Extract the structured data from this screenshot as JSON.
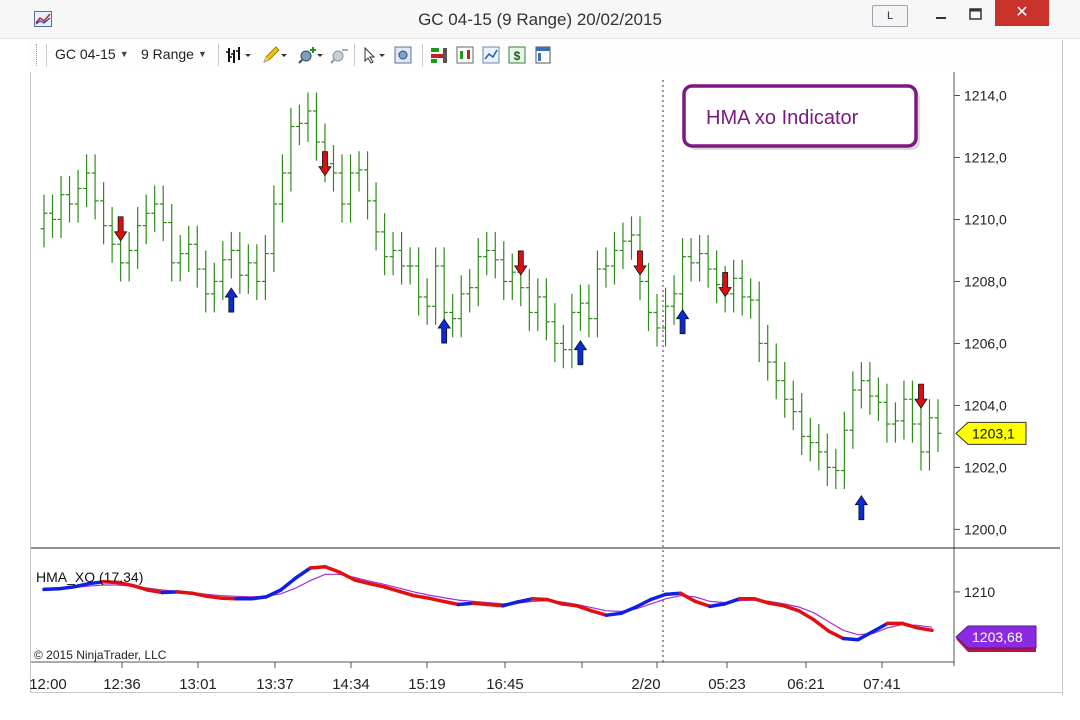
{
  "window": {
    "title": "GC 04-15 (9 Range)  20/02/2015",
    "layout_button": "L",
    "close_glyph": "✕"
  },
  "toolbar": {
    "instrument": "GC 04-15",
    "period": "9 Range"
  },
  "annotation": {
    "text": "HMA xo Indicator"
  },
  "indicator": {
    "label": "HMA_XO (17,34)",
    "price_tag": "1203,68",
    "axis_tick": "1210"
  },
  "copyright": "© 2015 NinjaTrader, LLC",
  "price_tag": "1203,1",
  "colors": {
    "bars": "#2e8b1a",
    "up_arrow": "#0a2bd8",
    "down_arrow": "#d81010",
    "hma_up": "#1020e0",
    "hma_down": "#e01010",
    "hma_signal": "#a030d0",
    "price_tag_bg": "#ffff00",
    "indicator_tag_bg": "#8a2be2",
    "annotation_border": "#7a1a80",
    "annotation_text": "#7a1a80"
  },
  "chart_data": {
    "type": "range-bar",
    "y_ticks": [
      "1214,0",
      "1212,0",
      "1210,0",
      "1208,0",
      "1206,0",
      "1204,0",
      "1202,0",
      "1200,0"
    ],
    "ylim": [
      1199.4,
      1214.5
    ],
    "x_ticks": [
      "12:00",
      "12:36",
      "13:01",
      "13:37",
      "14:34",
      "15:19",
      "16:45",
      "2/20",
      "05:23",
      "06:21",
      "07:41"
    ],
    "session_break_label": "2/20",
    "closes": [
      1210.2,
      1210.0,
      1210.8,
      1210.5,
      1211.0,
      1211.5,
      1210.6,
      1209.8,
      1209.2,
      1208.6,
      1209.0,
      1209.8,
      1210.2,
      1210.5,
      1209.9,
      1208.6,
      1208.9,
      1209.2,
      1208.4,
      1207.6,
      1208.0,
      1208.7,
      1209.0,
      1208.2,
      1208.6,
      1208.0,
      1208.9,
      1210.5,
      1211.5,
      1213.0,
      1213.1,
      1213.5,
      1212.5,
      1211.8,
      1211.5,
      1210.5,
      1211.5,
      1211.6,
      1210.6,
      1209.6,
      1208.8,
      1209.0,
      1208.5,
      1208.5,
      1207.5,
      1207.2,
      1208.5,
      1207.0,
      1206.8,
      1207.6,
      1207.8,
      1208.8,
      1209.0,
      1208.7,
      1208.0,
      1208.3,
      1207.8,
      1207.0,
      1207.5,
      1206.7,
      1206.0,
      1205.8,
      1207.0,
      1207.3,
      1206.8,
      1208.4,
      1208.5,
      1209.0,
      1209.3,
      1209.5,
      1208.0,
      1207.0,
      1206.5,
      1207.2,
      1207.6,
      1208.8,
      1208.6,
      1208.9,
      1208.4,
      1207.9,
      1207.6,
      1208.1,
      1207.5,
      1207.4,
      1206.0,
      1205.4,
      1204.8,
      1204.2,
      1203.8,
      1203.0,
      1202.8,
      1202.5,
      1202.0,
      1201.9,
      1203.2,
      1204.5,
      1204.8,
      1204.3,
      1204.1,
      1203.4,
      1203.5,
      1204.2,
      1203.4,
      1202.5,
      1203.6,
      1203.1
    ],
    "signals": [
      {
        "bar": 9,
        "dir": "down",
        "price": 1209.7
      },
      {
        "bar": 22,
        "dir": "up",
        "price": 1207.4
      },
      {
        "bar": 33,
        "dir": "down",
        "price": 1211.8
      },
      {
        "bar": 47,
        "dir": "up",
        "price": 1206.4
      },
      {
        "bar": 56,
        "dir": "down",
        "price": 1208.6
      },
      {
        "bar": 63,
        "dir": "up",
        "price": 1205.7
      },
      {
        "bar": 70,
        "dir": "down",
        "price": 1208.6
      },
      {
        "bar": 75,
        "dir": "up",
        "price": 1206.7
      },
      {
        "bar": 80,
        "dir": "down",
        "price": 1207.9
      },
      {
        "bar": 96,
        "dir": "up",
        "price": 1200.7
      },
      {
        "bar": 103,
        "dir": "down",
        "price": 1204.3
      }
    ],
    "indicator": {
      "name": "HMA_XO (17,34)",
      "ylim": [
        1199.5,
        1216.5
      ],
      "ytick_value": 1210,
      "hma": [
        1210.4,
        1210.5,
        1210.8,
        1211.3,
        1211.6,
        1211.5,
        1211.0,
        1210.3,
        1209.9,
        1210.0,
        1209.8,
        1209.3,
        1209.0,
        1208.9,
        1208.9,
        1209.2,
        1210.3,
        1212.2,
        1213.8,
        1214.0,
        1213.1,
        1211.9,
        1211.3,
        1210.8,
        1210.1,
        1209.4,
        1209.0,
        1208.5,
        1208.0,
        1208.2,
        1208.0,
        1207.8,
        1208.4,
        1208.9,
        1208.8,
        1208.1,
        1207.8,
        1207.0,
        1206.3,
        1206.6,
        1207.6,
        1208.8,
        1209.6,
        1209.8,
        1208.5,
        1207.7,
        1208.1,
        1208.9,
        1208.9,
        1208.2,
        1207.8,
        1207.0,
        1205.6,
        1203.8,
        1202.6,
        1202.4,
        1203.7,
        1205.0,
        1205.0,
        1204.3,
        1203.9
      ],
      "hma_dir": [
        "u",
        "u",
        "u",
        "u",
        "u",
        "d",
        "d",
        "d",
        "d",
        "u",
        "d",
        "d",
        "d",
        "d",
        "u",
        "u",
        "u",
        "u",
        "u",
        "d",
        "d",
        "d",
        "d",
        "d",
        "d",
        "d",
        "d",
        "d",
        "d",
        "u",
        "d",
        "d",
        "u",
        "u",
        "d",
        "d",
        "d",
        "d",
        "d",
        "u",
        "u",
        "u",
        "u",
        "u",
        "d",
        "d",
        "u",
        "u",
        "d",
        "d",
        "d",
        "d",
        "d",
        "d",
        "d",
        "u",
        "u",
        "u",
        "d",
        "d",
        "d"
      ],
      "signal": [
        1210.6,
        1210.6,
        1210.7,
        1210.9,
        1211.1,
        1211.1,
        1210.9,
        1210.6,
        1210.3,
        1210.1,
        1209.9,
        1209.6,
        1209.4,
        1209.3,
        1209.2,
        1209.3,
        1209.7,
        1210.6,
        1211.8,
        1212.8,
        1212.8,
        1212.3,
        1211.7,
        1211.2,
        1210.6,
        1210.0,
        1209.5,
        1209.1,
        1208.7,
        1208.5,
        1208.3,
        1208.1,
        1208.2,
        1208.5,
        1208.6,
        1208.4,
        1208.0,
        1207.5,
        1207.0,
        1206.9,
        1207.3,
        1208.1,
        1208.9,
        1209.4,
        1209.2,
        1208.5,
        1208.3,
        1208.6,
        1208.7,
        1208.5,
        1208.1,
        1207.6,
        1206.7,
        1205.3,
        1203.9,
        1203.2,
        1203.4,
        1204.3,
        1204.8,
        1204.7,
        1204.4
      ]
    }
  }
}
